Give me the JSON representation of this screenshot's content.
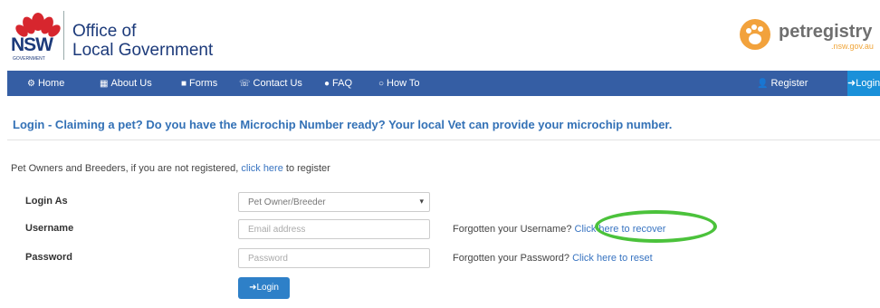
{
  "header": {
    "nsw": "NSW",
    "government": "GOVERNMENT",
    "office_line1": "Office of",
    "office_line2": "Local Government",
    "petregistry": "petregistry",
    "petregistry_sub": ".nsw.gov.au"
  },
  "nav": {
    "home": "Home",
    "about": "About Us",
    "forms": "Forms",
    "contact": "Contact Us",
    "faq": "FAQ",
    "howto": "How To",
    "register": "Register",
    "login": "Login"
  },
  "page": {
    "headline": "Login - Claiming a pet? Do you have the Microchip Number ready? Your local Vet can provide your microchip number.",
    "intro_before": "Pet Owners and Breeders, if you are not registered,",
    "intro_link": "click here",
    "intro_after": "to register"
  },
  "form": {
    "login_as_label": "Login As",
    "login_as_value": "Pet Owner/Breeder",
    "username_label": "Username",
    "username_placeholder": "Email address",
    "password_label": "Password",
    "password_placeholder": "Password",
    "forgot_username": "Forgotten your Username?",
    "recover_link": "Click here to recover",
    "forgot_password": "Forgotten your Password?",
    "reset_link": "Click here to reset",
    "login_button": "Login"
  },
  "colors": {
    "navbar": "#355ea4",
    "accent_blue": "#3371b6",
    "highlight_green": "#4bc23b"
  }
}
